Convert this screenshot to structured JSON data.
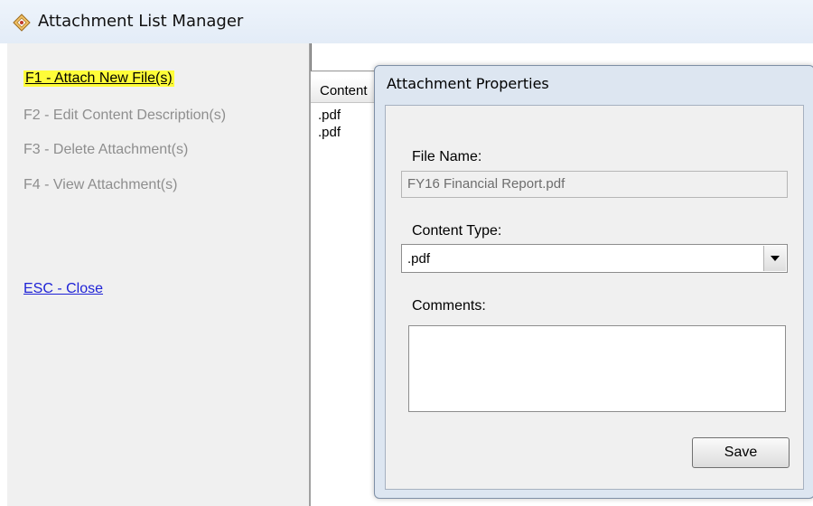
{
  "window": {
    "title": "Attachment List Manager",
    "icon": "app-diamond-icon"
  },
  "sidebar": {
    "items": [
      {
        "label": "F1 - Attach New File(s)",
        "state": "active"
      },
      {
        "label": "F2 - Edit Content Description(s)",
        "state": "disabled"
      },
      {
        "label": "F3 - Delete Attachment(s)",
        "state": "disabled"
      },
      {
        "label": "F4 - View Attachment(s)",
        "state": "disabled"
      },
      {
        "label": "ESC - Close",
        "state": "link"
      }
    ]
  },
  "grid": {
    "column_header": "Content",
    "rows": [
      ".pdf",
      ".pdf"
    ]
  },
  "dialog": {
    "title": "Attachment Properties",
    "file_name_label": "File Name:",
    "file_name_value": "FY16 Financial Report.pdf",
    "content_type_label": "Content Type:",
    "content_type_value": ".pdf",
    "comments_label": "Comments:",
    "comments_value": "",
    "save_label": "Save"
  },
  "colors": {
    "highlight": "#fffd39",
    "link": "#1f23d6",
    "disabled_text": "#8e8e8e",
    "dialog_frame": "#dde6f1"
  }
}
